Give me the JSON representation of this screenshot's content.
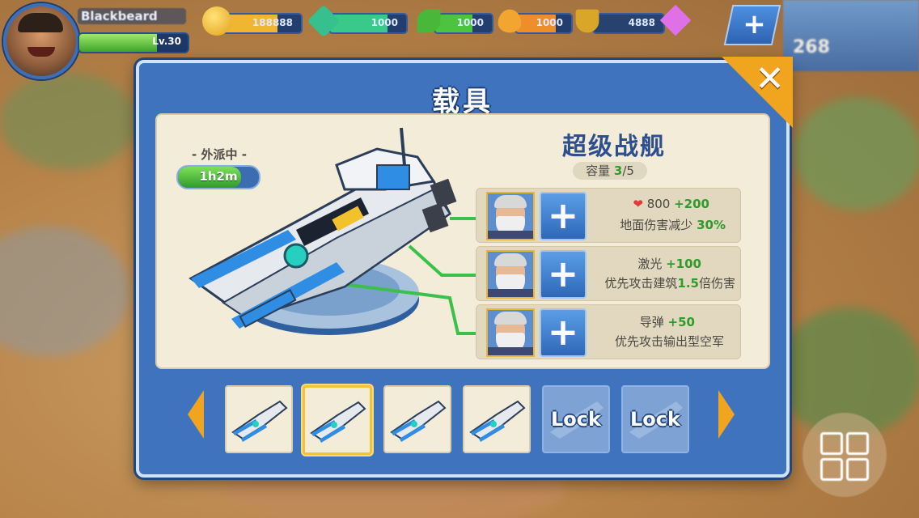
{
  "hud": {
    "player_name": "Blackbeard",
    "level_text": "Lv.30",
    "resources": [
      {
        "name": "gold",
        "value": "188888"
      },
      {
        "name": "crystal",
        "value": "1000"
      },
      {
        "name": "leaf",
        "value": "1000"
      },
      {
        "name": "oil",
        "value": "1000"
      },
      {
        "name": "trophy",
        "value": "4888"
      }
    ],
    "topright_text": "268"
  },
  "modal": {
    "title": "载具",
    "close_label": "✕",
    "status_label": "- 外派中 -",
    "timer": "1h2m",
    "timer_progress": 0.78,
    "ship_name": "超级战舰",
    "capacity_label": "容量",
    "capacity_current": "3",
    "capacity_total": "/5",
    "slots": [
      {
        "stat_value": "800",
        "bonus": "+200",
        "stat_icon": "heart-icon",
        "line2": "地面伤害减少",
        "line2_bonus": "30%"
      },
      {
        "stat_value": "激光",
        "bonus": "+100",
        "line2": "优先攻击建筑",
        "line2_bonus": "1.5",
        "line2_suffix": "倍伤害"
      },
      {
        "stat_value": "导弹",
        "bonus": "+50",
        "line2": "优先攻击输出型空军"
      }
    ],
    "add_label": "+",
    "vehicles": [
      {
        "state": "owned"
      },
      {
        "state": "selected"
      },
      {
        "state": "owned"
      },
      {
        "state": "owned"
      },
      {
        "state": "locked",
        "label": "Lock"
      },
      {
        "state": "locked",
        "label": "Lock"
      }
    ]
  },
  "colors": {
    "accent": "#f1a51f",
    "panel": "#f3ecd9",
    "frame": "#3f73bd",
    "bonus": "#2f9b2c"
  }
}
